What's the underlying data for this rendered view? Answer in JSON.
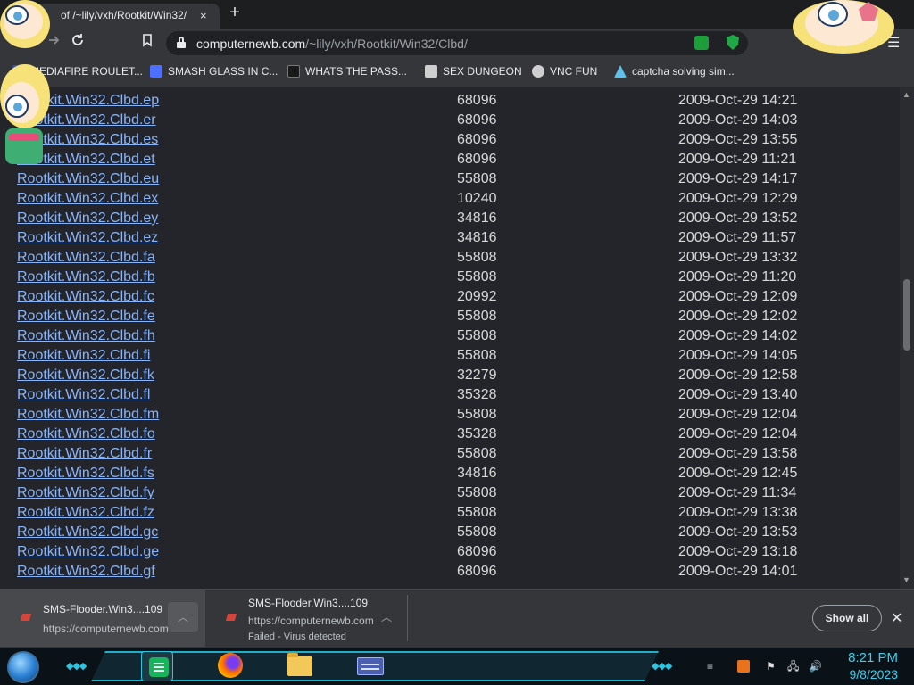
{
  "browser": {
    "tab_title": "of /~lily/vxh/Rootkit/Win32/",
    "tab_close": "×",
    "new_tab": "+",
    "url_domain": "computernewb.com",
    "url_path": "/~lily/vxh/Rootkit/Win32/Clbd/",
    "bookmarks": [
      {
        "label": "MEDIAFIRE ROULET...",
        "icon": "mediafire-icon",
        "color": "#2f4fb5"
      },
      {
        "label": "SMASH GLASS IN C...",
        "icon": "glass-icon",
        "color": "#4c6fff"
      },
      {
        "label": "WHATS THE PASS...",
        "icon": "ghost-icon",
        "color": "#1a1a1a"
      },
      {
        "label": "SEX DUNGEON",
        "icon": "cube-icon",
        "color": "#cfcfcf"
      },
      {
        "label": "VNC FUN",
        "icon": "gear-icon",
        "color": "#cfcfcf"
      },
      {
        "label": "captcha solving sim...",
        "icon": "a-icon",
        "color": "#5fc0e8"
      }
    ]
  },
  "listing": {
    "rows": [
      {
        "name": "Rootkit.Win32.Clbd.ep",
        "size": "68096",
        "date": "2009-Oct-29 14:21"
      },
      {
        "name": "Rootkit.Win32.Clbd.er",
        "size": "68096",
        "date": "2009-Oct-29 14:03"
      },
      {
        "name": "Rootkit.Win32.Clbd.es",
        "size": "68096",
        "date": "2009-Oct-29 13:55"
      },
      {
        "name": "Rootkit.Win32.Clbd.et",
        "size": "68096",
        "date": "2009-Oct-29 11:21"
      },
      {
        "name": "Rootkit.Win32.Clbd.eu",
        "size": "55808",
        "date": "2009-Oct-29 14:17"
      },
      {
        "name": "Rootkit.Win32.Clbd.ex",
        "size": "10240",
        "date": "2009-Oct-29 12:29"
      },
      {
        "name": "Rootkit.Win32.Clbd.ey",
        "size": "34816",
        "date": "2009-Oct-29 13:52"
      },
      {
        "name": "Rootkit.Win32.Clbd.ez",
        "size": "34816",
        "date": "2009-Oct-29 11:57"
      },
      {
        "name": "Rootkit.Win32.Clbd.fa",
        "size": "55808",
        "date": "2009-Oct-29 13:32"
      },
      {
        "name": "Rootkit.Win32.Clbd.fb",
        "size": "55808",
        "date": "2009-Oct-29 11:20"
      },
      {
        "name": "Rootkit.Win32.Clbd.fc",
        "size": "20992",
        "date": "2009-Oct-29 12:09"
      },
      {
        "name": "Rootkit.Win32.Clbd.fe",
        "size": "55808",
        "date": "2009-Oct-29 12:02"
      },
      {
        "name": "Rootkit.Win32.Clbd.fh",
        "size": "55808",
        "date": "2009-Oct-29 14:02"
      },
      {
        "name": "Rootkit.Win32.Clbd.fi",
        "size": "55808",
        "date": "2009-Oct-29 14:05"
      },
      {
        "name": "Rootkit.Win32.Clbd.fk",
        "size": "32279",
        "date": "2009-Oct-29 12:58"
      },
      {
        "name": "Rootkit.Win32.Clbd.fl",
        "size": "35328",
        "date": "2009-Oct-29 13:40"
      },
      {
        "name": "Rootkit.Win32.Clbd.fm",
        "size": "55808",
        "date": "2009-Oct-29 12:04"
      },
      {
        "name": "Rootkit.Win32.Clbd.fo",
        "size": "35328",
        "date": "2009-Oct-29 12:04"
      },
      {
        "name": "Rootkit.Win32.Clbd.fr",
        "size": "55808",
        "date": "2009-Oct-29 13:58"
      },
      {
        "name": "Rootkit.Win32.Clbd.fs",
        "size": "34816",
        "date": "2009-Oct-29 12:45"
      },
      {
        "name": "Rootkit.Win32.Clbd.fy",
        "size": "55808",
        "date": "2009-Oct-29 11:34"
      },
      {
        "name": "Rootkit.Win32.Clbd.fz",
        "size": "55808",
        "date": "2009-Oct-29 13:38"
      },
      {
        "name": "Rootkit.Win32.Clbd.gc",
        "size": "55808",
        "date": "2009-Oct-29 13:53"
      },
      {
        "name": "Rootkit.Win32.Clbd.ge",
        "size": "68096",
        "date": "2009-Oct-29 13:18"
      },
      {
        "name": "Rootkit.Win32.Clbd.gf",
        "size": "68096",
        "date": "2009-Oct-29 14:01"
      }
    ]
  },
  "downloads": {
    "items": [
      {
        "name": "SMS-Flooder.Win3....109",
        "url": "https://computernewb.com",
        "status": ""
      },
      {
        "name": "SMS-Flooder.Win3....109",
        "url": "https://computernewb.com",
        "status": "Failed - Virus detected"
      }
    ],
    "show_all": "Show all",
    "close": "✕"
  },
  "taskbar": {
    "time": "8:21 PM",
    "date": "9/8/2023",
    "accent": "#2ec4e0"
  }
}
